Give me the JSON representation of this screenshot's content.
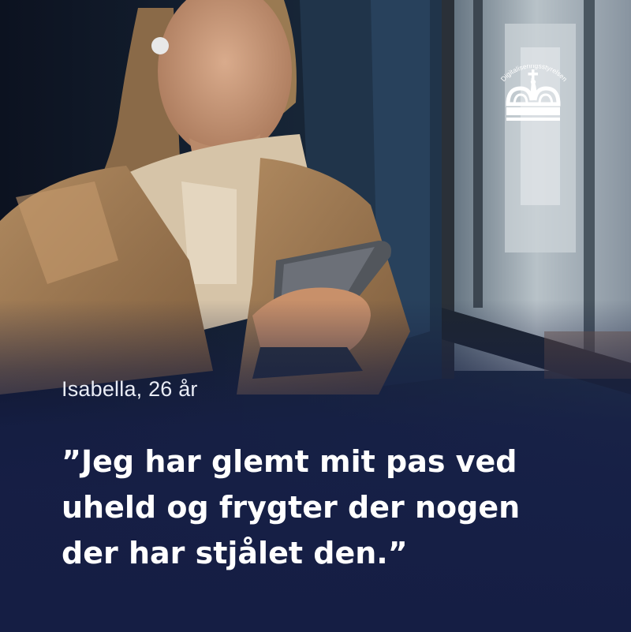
{
  "logo": {
    "arc_text": "Digitaliseringsstyrelsen",
    "icon": "crown-icon"
  },
  "caption": "Isabella, 26 år",
  "quote": {
    "line1": "”Jeg har glemt mit pas ved",
    "line2": "uheld og frygter der nogen",
    "line3": "der har stjålet den.”"
  },
  "colors": {
    "overlay": "#16203f",
    "text": "#ffffff",
    "coat": "#a47e56",
    "hoodie": "#d8c7ad"
  }
}
